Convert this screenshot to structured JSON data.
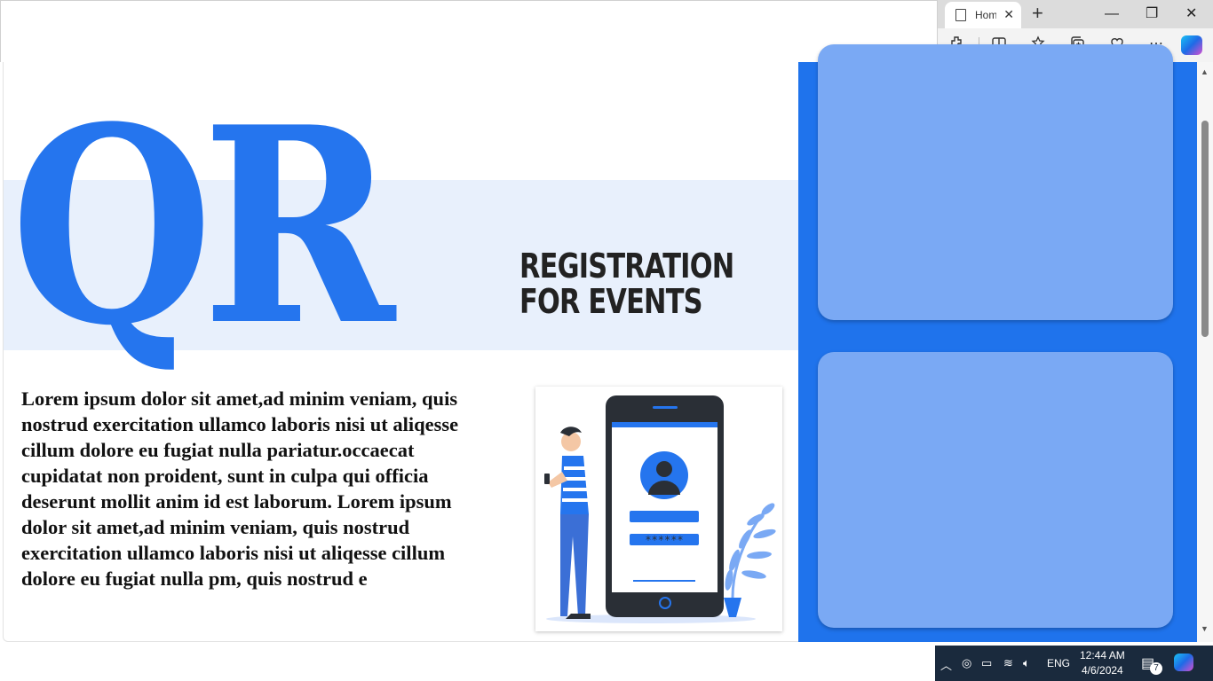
{
  "browser": {
    "tab_title": "Hom",
    "new_tab": "+",
    "minimize": "—",
    "restore": "❐",
    "close": "✕"
  },
  "hero": {
    "big_letters": "QR",
    "subtitle_line1": "REGISTRATION",
    "subtitle_line2": "FOR EVENTS"
  },
  "body_text": "Lorem ipsum dolor sit amet,ad minim veniam, quis nostrud exercitation ullamco laboris nisi ut aliqesse cillum dolore eu fugiat nulla pariatur.occaecat cupidatat non proident, sunt in culpa qui officia deserunt mollit anim id est laborum. Lorem ipsum dolor sit amet,ad minim veniam, quis nostrud exercitation ullamco laboris nisi ut aliqesse cillum dolore eu fugiat nulla pm, quis nostrud e",
  "illustration": {
    "password_mask": "******"
  },
  "colors": {
    "accent": "#2575ee",
    "panel": "#1f73ec",
    "card": "#7aa9f4"
  },
  "taskbar": {
    "language": "ENG",
    "time": "12:44 AM",
    "date": "4/6/2024",
    "notification_count": "7"
  }
}
